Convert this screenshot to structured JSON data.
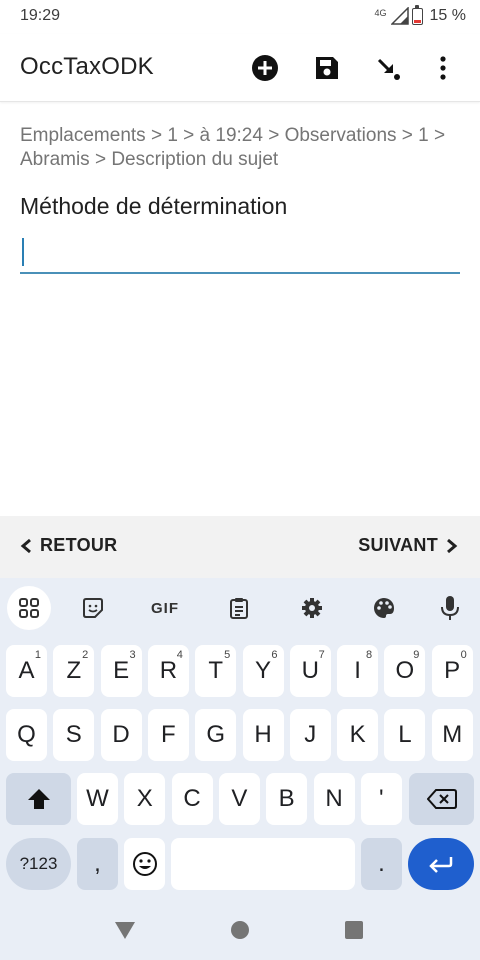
{
  "status_bar": {
    "time": "19:29",
    "network": "4G",
    "battery": "15 %",
    "battery_level": 0.15
  },
  "app_bar": {
    "title": "OccTaxODK",
    "actions": [
      {
        "name": "add-icon"
      },
      {
        "name": "save-icon"
      },
      {
        "name": "jump-icon"
      },
      {
        "name": "more-vert-icon"
      }
    ]
  },
  "form": {
    "breadcrumb": "Emplacements > 1 > à 19:24 > Observations > 1 > Abramis > Description du sujet",
    "question": "Méthode de détermination",
    "answer_value": "",
    "accent_color": "#4a90b8"
  },
  "navigation": {
    "back_label": "RETOUR",
    "next_label": "SUIVANT"
  },
  "keyboard": {
    "toolbar": [
      "apps-icon",
      "sticker-icon",
      "gif-icon",
      "clipboard-icon",
      "settings-icon",
      "palette-icon",
      "mic-icon"
    ],
    "gif_label": "GIF",
    "row1": [
      {
        "key": "A",
        "hint": "1"
      },
      {
        "key": "Z",
        "hint": "2"
      },
      {
        "key": "E",
        "hint": "3"
      },
      {
        "key": "R",
        "hint": "4"
      },
      {
        "key": "T",
        "hint": "5"
      },
      {
        "key": "Y",
        "hint": "6"
      },
      {
        "key": "U",
        "hint": "7"
      },
      {
        "key": "I",
        "hint": "8"
      },
      {
        "key": "O",
        "hint": "9"
      },
      {
        "key": "P",
        "hint": "0"
      }
    ],
    "row2": [
      "Q",
      "S",
      "D",
      "F",
      "G",
      "H",
      "J",
      "K",
      "L",
      "M"
    ],
    "row3": [
      "W",
      "X",
      "C",
      "V",
      "B",
      "N",
      "'"
    ],
    "symbols_label": "?123",
    "comma": ",",
    "period": ".",
    "enter_color": "#1f5fce"
  }
}
